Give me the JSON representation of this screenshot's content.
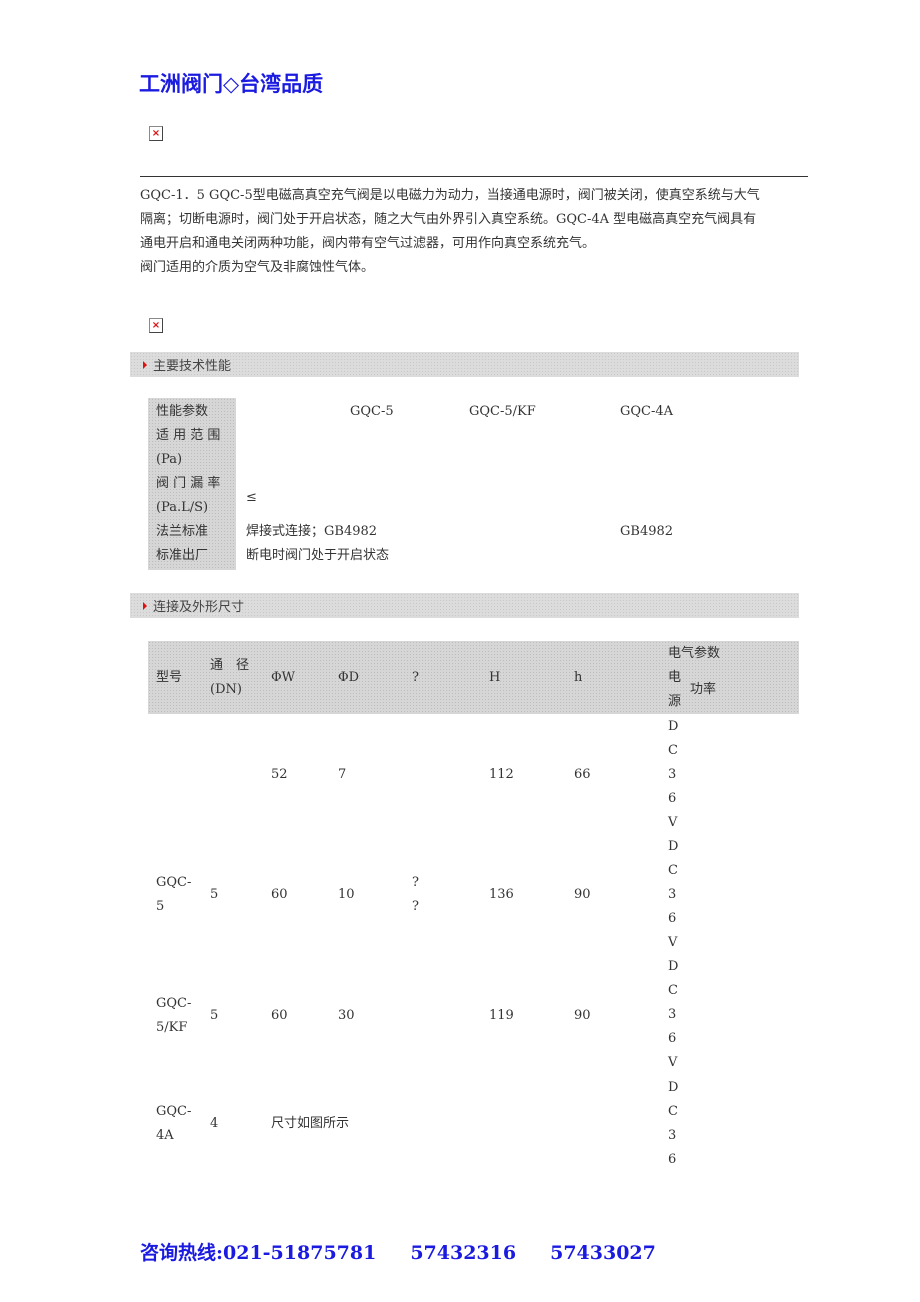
{
  "page_title": "工洲阀门◇台湾品质",
  "broken_image_icon": "×",
  "intro": {
    "lines": [
      "GQC-1．5 GQC-5型电磁高真空充气阀是以电磁力为动力，当接通电源时，阀门被关闭，使真空系统与大气",
      "隔离；切断电源时，阀门处于开启状态，随之大气由外界引入真空系统。GQC-4A 型电磁高真空充气阀具有",
      "通电开启和通电关闭两种功能，阀内带有空气过滤器，可用作向真空系统充气。",
      "阀门适用的介质为空气及非腐蚀性气体。"
    ]
  },
  "section1": {
    "title": "主要技术性能",
    "table": {
      "header": {
        "label": "性能参数",
        "cols": [
          "GQC-5",
          "GQC-5/KF",
          "GQC-4A"
        ]
      },
      "rows": [
        {
          "label_line1": "适 用 范 围",
          "label_line2": "(Pa)",
          "values": [
            "",
            "",
            ""
          ]
        },
        {
          "label_line1": "阀 门 漏 率",
          "label_line2": "(Pa.L/S)",
          "values": [
            "≤",
            "",
            ""
          ]
        },
        {
          "label": "法兰标准",
          "values": [
            "焊接式连接；GB4982",
            "",
            "GB4982"
          ]
        },
        {
          "label": "标准出厂",
          "values": [
            "断电时阀门处于开启状态",
            "",
            ""
          ]
        }
      ]
    }
  },
  "section2": {
    "title": "连接及外形尺寸",
    "table": {
      "headers": {
        "model": "型号",
        "dn_line1": "通　径",
        "dn_line2": "(DN)",
        "phiW": "ΦW",
        "phiD": "ΦD",
        "q": "?",
        "H": "H",
        "h": "h",
        "electric": "电气参数",
        "power_source_line1": "电",
        "power_source_line2": "源",
        "power": "功率"
      },
      "rows": [
        {
          "model_line1": "",
          "model_line2": "",
          "dn": "",
          "phiW": "52",
          "phiD": "7",
          "q_line1": "",
          "q_line2": "",
          "H": "112",
          "h": "66",
          "source": "DC36V"
        },
        {
          "model_line1": "GQC-",
          "model_line2": "5",
          "dn": "5",
          "phiW": "60",
          "phiD": "10",
          "q_line1": "?",
          "q_line2": "?",
          "H": "136",
          "h": "90",
          "source": "DC36V"
        },
        {
          "model_line1": "GQC-",
          "model_line2": "5/KF",
          "dn": "5",
          "phiW": "60",
          "phiD": "30",
          "q_line1": "",
          "q_line2": "",
          "H": "119",
          "h": "90",
          "source": "DC36V"
        },
        {
          "model_line1": "GQC-",
          "model_line2": "4A",
          "dn": "4",
          "phiW": "尺寸如图所示",
          "phiD": "",
          "q_line1": "",
          "q_line2": "",
          "H": "",
          "h": "",
          "source": "DC36"
        }
      ]
    }
  },
  "footer": {
    "label": "咨询热线:021-51875781",
    "phone2": "57432316",
    "phone3": "57433027"
  }
}
